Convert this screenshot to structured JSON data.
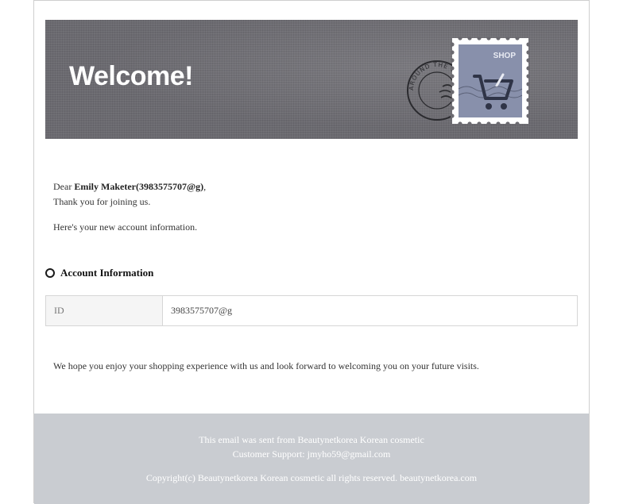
{
  "banner": {
    "title": "Welcome!",
    "stamp_label": "SHOP",
    "postmark_text": "AROUND THE WORLD",
    "bg_color": "#6b6a70",
    "stamp_color": "#8890ab"
  },
  "greeting": {
    "dear": "Dear",
    "name": "Emily Maketer(3983575707@g)",
    "comma": ",",
    "thanks": "Thank you for joining us.",
    "intro": "Here's your new account information."
  },
  "account_section": {
    "title": "Account Information",
    "rows": [
      {
        "key": "ID",
        "value": "3983575707@g"
      }
    ]
  },
  "closing": "We hope you enjoy your shopping experience with us and look forward to welcoming you on your future visits.",
  "footer": {
    "sent_from": "This email was sent from Beautynetkorea Korean cosmetic",
    "support": "Customer Support: jmyho59@gmail.com",
    "copyright": "Copyright(c) Beautynetkorea Korean cosmetic all rights reserved. beautynetkorea.com",
    "bg_color": "#c9ccd1"
  }
}
